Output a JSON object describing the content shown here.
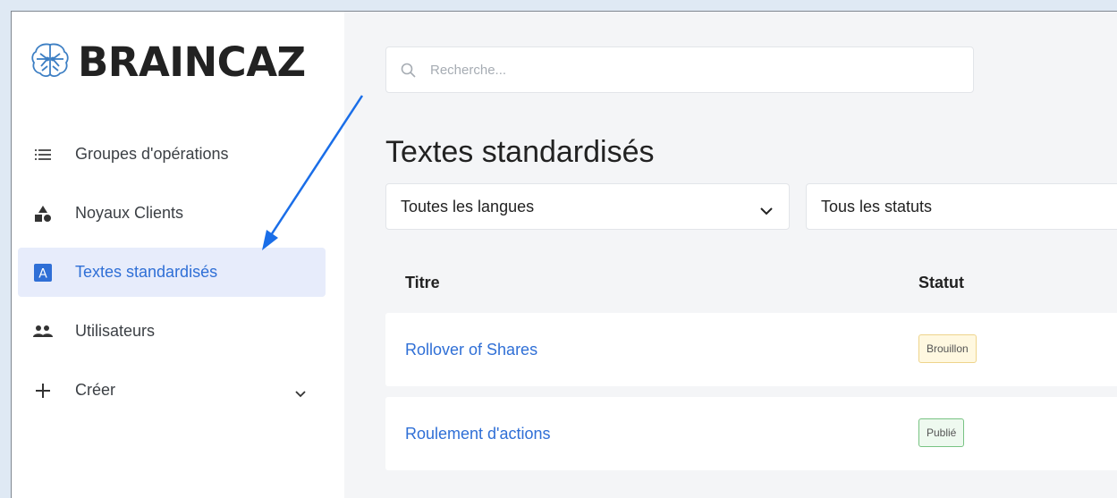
{
  "brand": {
    "name": "BRAINCAZ"
  },
  "sidebar": {
    "items": [
      {
        "label": "Groupes d'opérations",
        "icon": "list-icon"
      },
      {
        "label": "Noyaux Clients",
        "icon": "shapes-icon"
      },
      {
        "label": "Textes standardisés",
        "icon": "text-a-icon",
        "active": true
      },
      {
        "label": "Utilisateurs",
        "icon": "users-icon"
      },
      {
        "label": "Créer",
        "icon": "plus-icon",
        "expandable": true
      }
    ]
  },
  "search": {
    "placeholder": "Recherche..."
  },
  "page": {
    "title": "Textes standardisés"
  },
  "filters": {
    "language": {
      "selected": "Toutes les langues"
    },
    "status": {
      "selected": "Tous les statuts"
    }
  },
  "table": {
    "headers": {
      "title": "Titre",
      "status": "Statut"
    },
    "rows": [
      {
        "title": "Rollover of Shares",
        "status": "Brouillon"
      },
      {
        "title": "Roulement d'actions",
        "status": "Publié"
      }
    ]
  },
  "colors": {
    "accent": "#2f6fd6",
    "active_bg": "#e7ecfb",
    "annotation_arrow": "#1a6ee8",
    "draft_border": "#eed48b",
    "published_border": "#78c383"
  }
}
